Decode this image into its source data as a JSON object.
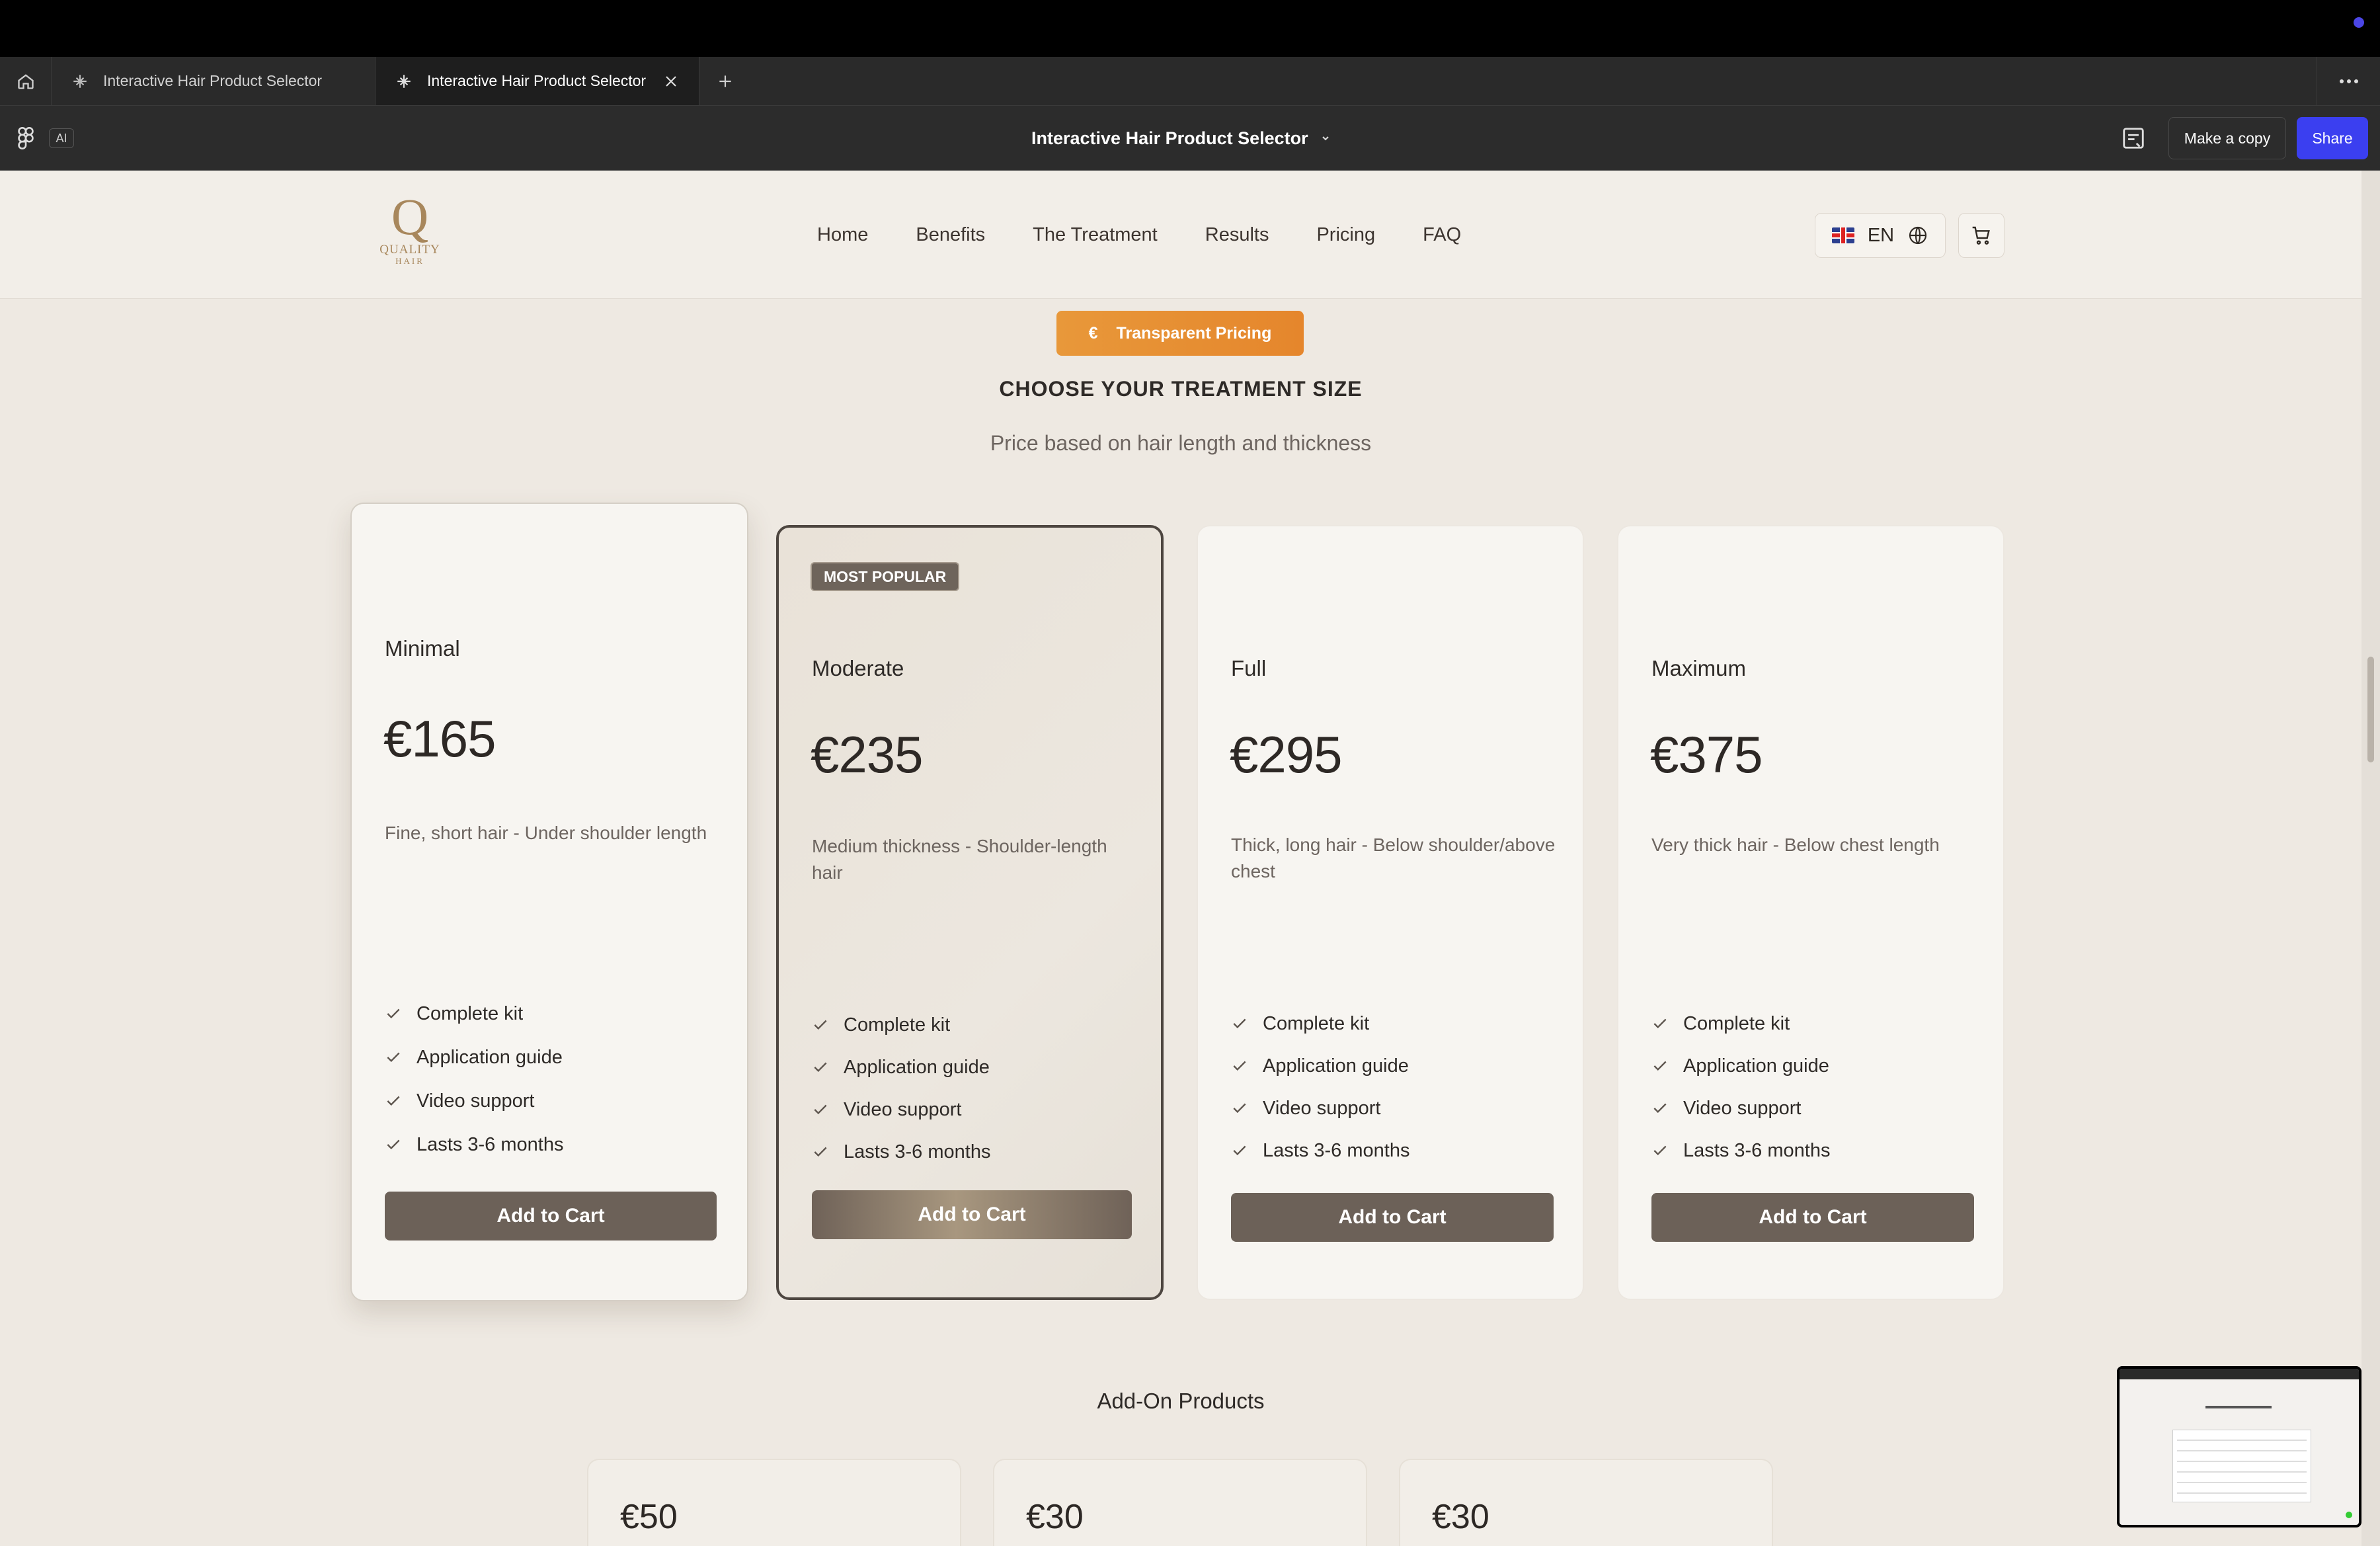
{
  "tabs": [
    {
      "label": "Interactive Hair Product Selector",
      "active": false
    },
    {
      "label": "Interactive Hair Product Selector",
      "active": true
    }
  ],
  "toolbar": {
    "ai_label": "AI",
    "file_title": "Interactive Hair Product Selector",
    "make_copy_label": "Make a copy",
    "share_label": "Share"
  },
  "site": {
    "logo_letter": "Q",
    "logo_line1": "QUALITY",
    "logo_line2": "HAIR",
    "nav": [
      "Home",
      "Benefits",
      "The Treatment",
      "Results",
      "Pricing",
      "FAQ"
    ],
    "language": "EN"
  },
  "pricing": {
    "pill_icon": "€",
    "pill_label": "Transparent Pricing",
    "title": "CHOOSE YOUR TREATMENT SIZE",
    "subtitle": "Price based on hair length and thickness"
  },
  "cards": [
    {
      "name": "Minimal",
      "price": "€165",
      "description": "Fine, short hair - Under shoulder length",
      "features": [
        "Complete kit",
        "Application guide",
        "Video support",
        "Lasts 3-6 months"
      ],
      "button": "Add to Cart"
    },
    {
      "badge": "MOST POPULAR",
      "name": "Moderate",
      "price": "€235",
      "description": "Medium thickness - Shoulder-length hair",
      "features": [
        "Complete kit",
        "Application guide",
        "Video support",
        "Lasts 3-6 months"
      ],
      "button": "Add to Cart"
    },
    {
      "name": "Full",
      "price": "€295",
      "description": "Thick, long hair - Below shoulder/above chest",
      "features": [
        "Complete kit",
        "Application guide",
        "Video support",
        "Lasts 3-6 months"
      ],
      "button": "Add to Cart"
    },
    {
      "name": "Maximum",
      "price": "€375",
      "description": "Very thick hair - Below chest length",
      "features": [
        "Complete kit",
        "Application guide",
        "Video support",
        "Lasts 3-6 months"
      ],
      "button": "Add to Cart"
    }
  ],
  "addons": {
    "title": "Add-On Products",
    "prices": [
      "€50",
      "€30",
      "€30"
    ]
  },
  "colors": {
    "accent_orange": "#e8983a",
    "button_brown": "#6c6158",
    "share_blue": "#3b3ff0"
  }
}
